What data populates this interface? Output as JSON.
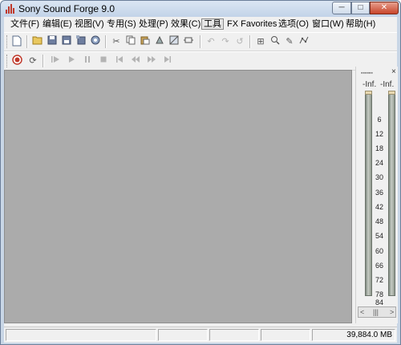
{
  "window": {
    "title": "Sony Sound Forge 9.0",
    "min_glyph": "─",
    "max_glyph": "□",
    "close_glyph": "✕"
  },
  "menu": {
    "items": [
      "文件(F)",
      "编辑(E)",
      "视图(V)",
      "专用(S)",
      "处理(P)",
      "效果(C)",
      "工具",
      "FX Favorites",
      "选项(O)",
      "窗口(W)",
      "帮助(H)"
    ],
    "active_index": 6
  },
  "meter": {
    "left_label": "-Inf.",
    "right_label": "-Inf.",
    "close_glyph": "×",
    "grip_text": "▪▪▪▪▪▪",
    "ticks": [
      "6",
      "12",
      "18",
      "24",
      "30",
      "36",
      "42",
      "48",
      "54",
      "60",
      "66",
      "72",
      "78",
      "84"
    ],
    "scroll_left": "<",
    "scroll_mid": "|||",
    "scroll_right": ">"
  },
  "status": {
    "disk_space": "39,884.0 MB"
  },
  "colors": {
    "workspace": "#ababab",
    "titlebar": "#c2d3e8",
    "record": "#c0392b"
  }
}
